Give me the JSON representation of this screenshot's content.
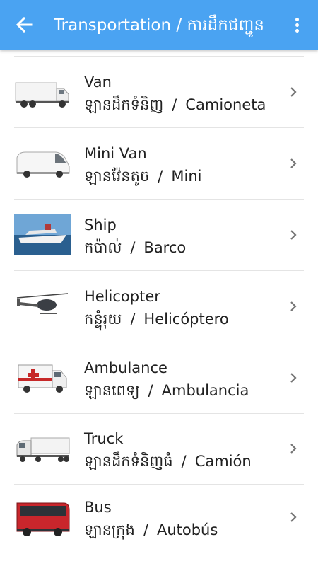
{
  "header": {
    "title": "Transportation / ការដឹកជញ្ជូន",
    "back_icon": "arrow-back-icon",
    "menu_icon": "more-vert-icon"
  },
  "colors": {
    "appbar": "#4aa3f2",
    "text": "#212121",
    "chevron": "#757575",
    "divider": "#e4e4e4"
  },
  "items": [
    {
      "name": "Van",
      "khmer": "ឡានដឹកទំនិញ",
      "spanish": "Camioneta",
      "separator": "/"
    },
    {
      "name": "Mini Van",
      "khmer": "ឡានវ៉ែនតូច",
      "spanish": "Mini",
      "separator": "/"
    },
    {
      "name": "Ship",
      "khmer": "កប៉ាល់",
      "spanish": "Barco",
      "separator": "/"
    },
    {
      "name": "Helicopter",
      "khmer": "កន្ទុំរុយ",
      "spanish": "Helicóptero",
      "separator": "/"
    },
    {
      "name": "Ambulance",
      "khmer": "ឡានពេទ្យ",
      "spanish": "Ambulancia",
      "separator": "/"
    },
    {
      "name": "Truck",
      "khmer": "ឡានដឹកទំនិញធំ",
      "spanish": "Camión",
      "separator": "/"
    },
    {
      "name": "Bus",
      "khmer": "ឡានក្រុង",
      "spanish": "Autobús",
      "separator": "/"
    }
  ]
}
